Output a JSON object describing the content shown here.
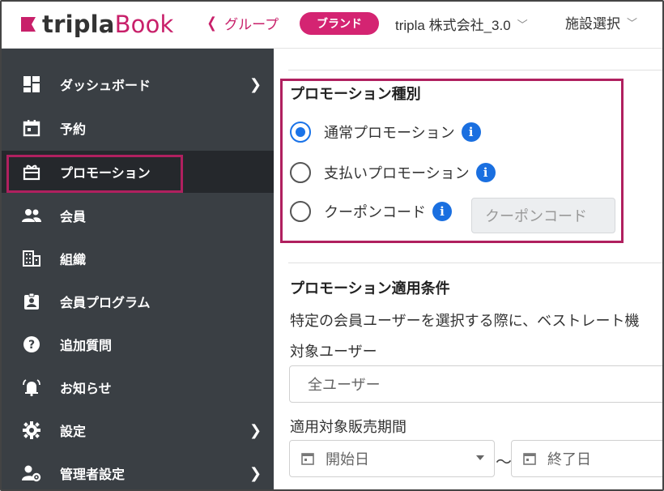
{
  "header": {
    "logo_text_a": "tripla",
    "logo_text_b": "Book",
    "back_label": "グループ",
    "brand_pill": "ブランド",
    "company": "tripla 株式会社_3.0",
    "facility": "施設選択",
    "brand_color": "#d42472"
  },
  "sidebar": {
    "items": [
      {
        "label": "ダッシュボード",
        "icon": "dashboard-icon",
        "has_arrow": true
      },
      {
        "label": "予約",
        "icon": "calendar-icon",
        "has_arrow": false
      },
      {
        "label": "プロモーション",
        "icon": "gift-icon",
        "has_arrow": false,
        "active": true
      },
      {
        "label": "会員",
        "icon": "people-icon",
        "has_arrow": false
      },
      {
        "label": "組織",
        "icon": "building-icon",
        "has_arrow": false
      },
      {
        "label": "会員プログラム",
        "icon": "badge-icon",
        "has_arrow": false
      },
      {
        "label": "追加質問",
        "icon": "question-icon",
        "has_arrow": false
      },
      {
        "label": "お知らせ",
        "icon": "bell-icon",
        "has_arrow": false
      },
      {
        "label": "設定",
        "icon": "gear-icon",
        "has_arrow": true
      },
      {
        "label": "管理者設定",
        "icon": "admin-icon",
        "has_arrow": true
      }
    ],
    "bg_color": "#3a3f44"
  },
  "promotion_type": {
    "title": "プロモーション種別",
    "options": [
      {
        "label": "通常プロモーション",
        "checked": true
      },
      {
        "label": "支払いプロモーション",
        "checked": false
      },
      {
        "label": "クーポンコード",
        "checked": false
      }
    ],
    "coupon_placeholder": "クーポンコード"
  },
  "conditions": {
    "title": "プロモーション適用条件",
    "description": "特定の会員ユーザーを選択する際に、ベストレート機",
    "target_label": "対象ユーザー",
    "target_value": "全ユーザー",
    "period_label": "適用対象販売期間",
    "start_placeholder": "開始日",
    "tilde": "〜",
    "end_placeholder": "終了日"
  },
  "highlight_color": "#b0205f"
}
